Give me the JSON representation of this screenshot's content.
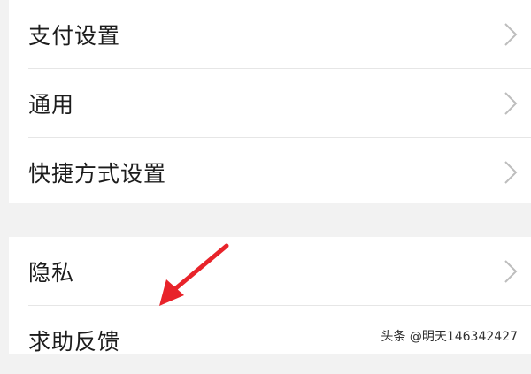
{
  "settings": {
    "group1": [
      {
        "label": "支付设置",
        "icon": "chevron-right-icon"
      },
      {
        "label": "通用",
        "icon": "chevron-right-icon"
      },
      {
        "label": "快捷方式设置",
        "icon": "chevron-right-icon"
      }
    ],
    "group2": [
      {
        "label": "隐私",
        "icon": "chevron-right-icon"
      },
      {
        "label": "求助反馈",
        "icon": "chevron-right-icon"
      }
    ]
  },
  "watermark": {
    "text": "头条 @明天146342427"
  },
  "colors": {
    "background": "#f2f2f2",
    "card": "#ffffff",
    "text": "#1c1c1c",
    "chevron": "#bdbdbd",
    "divider": "#e6e6e6",
    "annotation_arrow": "#e8232a"
  }
}
